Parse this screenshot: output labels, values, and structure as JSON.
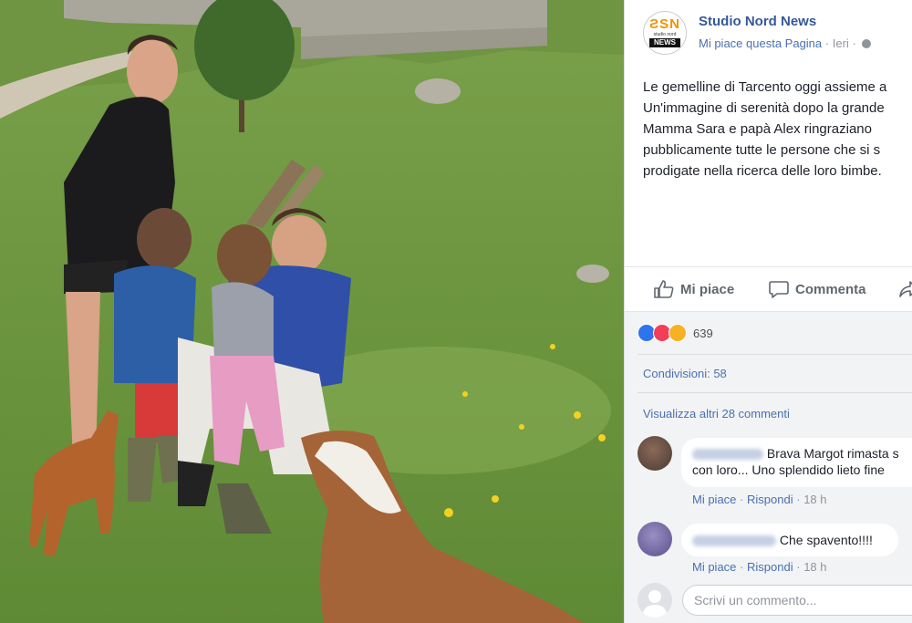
{
  "post": {
    "page_name": "Studio Nord News",
    "like_page": "Mi piace questa Pagina",
    "separator": "·",
    "time": "Ieri",
    "logo": {
      "top": "ƧSN",
      "middle": "studio nord",
      "bottom": "NEWS"
    },
    "text_lines": [
      "Le gemelline di Tarcento oggi assieme a",
      "Un'immagine di serenità dopo la grande",
      "Mamma Sara e papà Alex ringraziano",
      "pubblicamente tutte le persone che si s",
      "prodigate nella ricerca delle loro bimbe."
    ]
  },
  "actions": {
    "like": "Mi piace",
    "comment": "Commenta"
  },
  "stats": {
    "reaction_count": "639",
    "reactions": [
      "like",
      "love",
      "haha"
    ],
    "shares": "Condivisioni: 58",
    "more_comments": "Visualizza altri 28 commenti"
  },
  "comments": [
    {
      "text_line1": "Brava Margot rimasta s",
      "text_line2": "con loro... Uno splendido lieto fine",
      "like": "Mi piace",
      "reply": "Rispondi",
      "dot": "·",
      "time": "18 h"
    },
    {
      "text_line1": "Che spavento!!!!",
      "like": "Mi piace",
      "reply": "Rispondi",
      "dot": "·",
      "time": "18 h"
    }
  ],
  "compose": {
    "placeholder": "Scrivi un commento..."
  },
  "colors": {
    "link_blue": "#365899",
    "meta_gray": "#90949c",
    "text": "#1d2129",
    "panel_gray": "#f2f3f5",
    "like_blue": "#2e74ee",
    "love_red": "#f33e58",
    "haha_yellow": "#f7b125"
  },
  "icons": {
    "like": "thumbs-up-icon",
    "comment": "speech-bubble-icon",
    "share": "share-arrow-icon",
    "privacy": "globe-icon"
  }
}
